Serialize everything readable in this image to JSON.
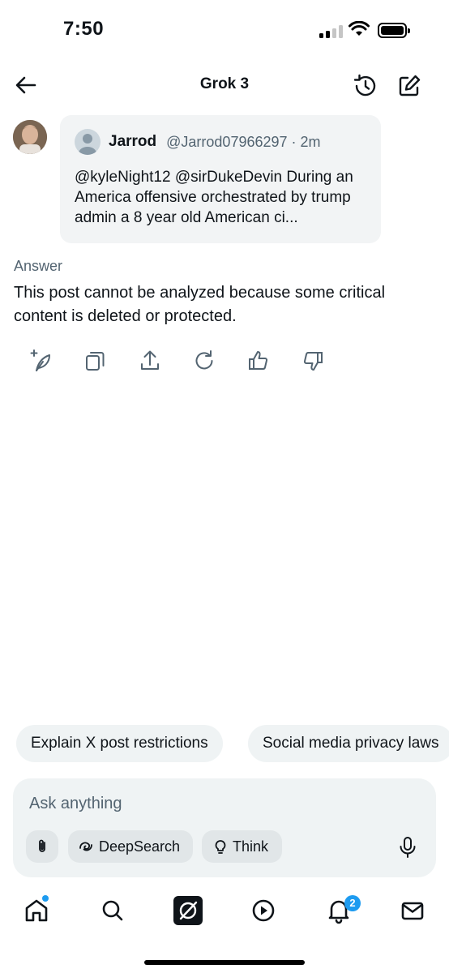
{
  "status": {
    "time": "7:50"
  },
  "header": {
    "title": "Grok 3"
  },
  "quote": {
    "name": "Jarrod",
    "handle": "@Jarrod07966297 · 2m",
    "text": "@kyleNight12 @sirDukeDevin During an America offensive orchestrated by trump admin a 8 year old American ci..."
  },
  "answer": {
    "label": "Answer",
    "text": "This post cannot be analyzed because some critical content is deleted or protected."
  },
  "actions": [
    "sparkle-feather-icon",
    "copy-icon",
    "share-icon",
    "regenerate-icon",
    "thumbs-up-icon",
    "thumbs-down-icon"
  ],
  "suggestions": [
    "Explain X post restrictions",
    "Social media privacy laws"
  ],
  "composer": {
    "placeholder": "Ask anything",
    "deepsearch_label": "DeepSearch",
    "think_label": "Think"
  },
  "tabbar": {
    "notifications_badge": "2",
    "accent_color": "#1d9bf0"
  }
}
